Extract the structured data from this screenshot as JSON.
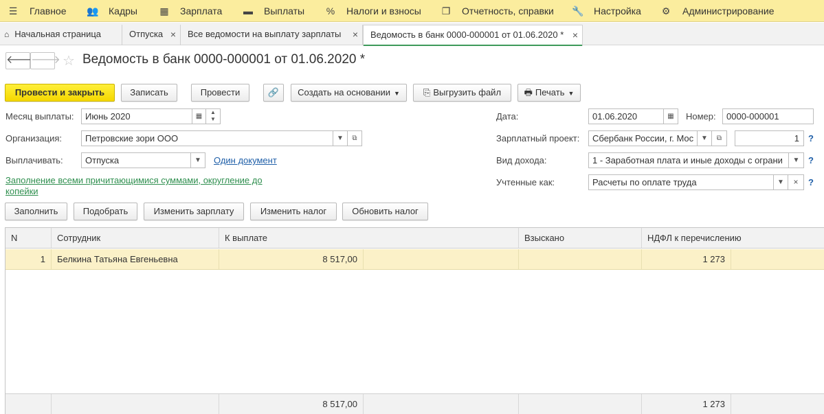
{
  "menu": [
    {
      "icon": "hamburger-icon",
      "label": "Главное"
    },
    {
      "icon": "users-icon",
      "label": "Кадры"
    },
    {
      "icon": "calculator-icon",
      "label": "Зарплата"
    },
    {
      "icon": "wallet-icon",
      "label": "Выплаты"
    },
    {
      "icon": "percent-icon",
      "label": "Налоги и взносы"
    },
    {
      "icon": "documents-icon",
      "label": "Отчетность, справки"
    },
    {
      "icon": "wrench-icon",
      "label": "Настройка"
    },
    {
      "icon": "gear-icon",
      "label": "Администрирование"
    }
  ],
  "tabs": [
    {
      "label": "Начальная страница"
    },
    {
      "label": "Отпуска"
    },
    {
      "label": "Все ведомости на выплату зарплаты"
    },
    {
      "label": "Ведомость в банк 0000-000001 от 01.06.2020 *"
    }
  ],
  "document": {
    "title": "Ведомость в банк 0000-000001 от 01.06.2020 *"
  },
  "toolbar": {
    "post_close": "Провести и закрыть",
    "save": "Записать",
    "post": "Провести",
    "create_based": "Создать на основании",
    "export_file": "Выгрузить файл",
    "print": "Печать"
  },
  "form": {
    "month_label": "Месяц выплаты:",
    "month_value": "Июнь 2020",
    "org_label": "Организация:",
    "org_value": "Петровские зори ООО",
    "pay_label": "Выплачивать:",
    "pay_value": "Отпуска",
    "one_doc_link": "Один документ",
    "fill_link": "Заполнение всеми причитающимися суммами, округление до копейки",
    "date_label": "Дата:",
    "date_value": "01.06.2020",
    "number_label": "Номер:",
    "number_value": "0000-000001",
    "project_label": "Зарплатный проект:",
    "project_value": "Сбербанк России, г. Мос",
    "project_count": "1",
    "income_label": "Вид дохода:",
    "income_value": "1 - Заработная плата и иные доходы с ограни",
    "account_label": "Учтенные как:",
    "account_value": "Расчеты по оплате труда",
    "help": "?"
  },
  "actions": {
    "fill": "Заполнить",
    "pick": "Подобрать",
    "change_salary": "Изменить зарплату",
    "change_tax": "Изменить налог",
    "update_tax": "Обновить налог"
  },
  "table": {
    "headers": {
      "n": "N",
      "employee": "Сотрудник",
      "to_pay": "К выплате",
      "recovered": "Взыскано",
      "ndfl": "НДФЛ к перечислению"
    },
    "rows": [
      {
        "n": "1",
        "employee": "Белкина Татьяна Евгеньевна",
        "to_pay": "8 517,00",
        "recovered": "",
        "ndfl": "1 273"
      }
    ],
    "totals": {
      "to_pay": "8 517,00",
      "ndfl": "1 273"
    }
  }
}
